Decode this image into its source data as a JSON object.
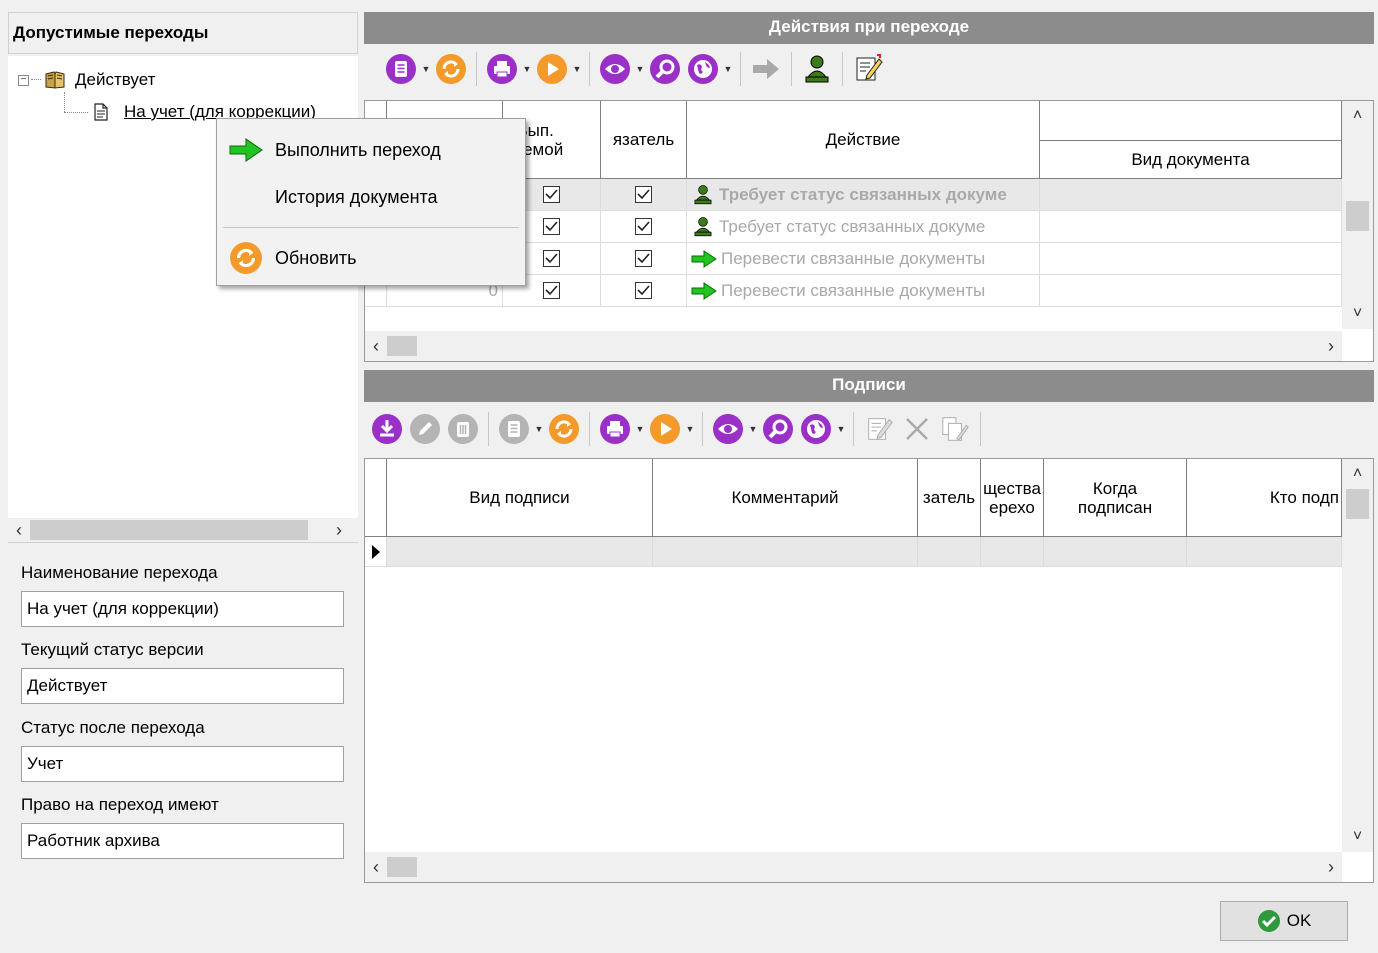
{
  "tree": {
    "header": "Допустимые переходы",
    "root_label": "Действует",
    "child_label": "На учет (для коррекции)"
  },
  "fields": {
    "name_label": "Наименование перехода",
    "name_value": "На учет (для коррекции)",
    "current_status_label": "Текущий статус версии",
    "current_status_value": "Действует",
    "after_status_label": "Статус после перехода",
    "after_status_value": "Учет",
    "rights_label": "Право на переход имеют",
    "rights_value": "Работник архива"
  },
  "actions_section": {
    "title": "Действия при переходе",
    "columns": {
      "exec_by_system": "Вып.\nстемой",
      "mandatory": "язатель",
      "action": "Действие",
      "doc_type": "Вид документа"
    },
    "rows": [
      {
        "action": "Требует статус связанных докуме",
        "icon": "user-stamp-icon",
        "bold": true
      },
      {
        "action": "Требует статус связанных докуме",
        "icon": "user-stamp-icon",
        "bold": false
      },
      {
        "action": "Перевести связанные документы",
        "icon": "green-arrow-icon",
        "bold": false
      },
      {
        "action": "Перевести связанные документы",
        "icon": "green-arrow-icon",
        "bold": false
      }
    ],
    "last_row_first_cell": "0"
  },
  "signatures_section": {
    "title": "Подписи",
    "columns": {
      "sign_type": "Вид подписи",
      "comment": "Комментарий",
      "col3": "затель",
      "col4": "щества\nерехо",
      "when_signed": "Когда\nподписан",
      "who_signed": "Кто подп"
    }
  },
  "context_menu": {
    "execute": "Выполнить переход",
    "history": "История документа",
    "refresh": "Обновить"
  },
  "ok_label": "OK",
  "colors": {
    "header_gray": "#8c8c8c",
    "purple_icon": "#9b30c8",
    "orange_icon": "#f39a2b",
    "green_arrow": "#22c422"
  }
}
